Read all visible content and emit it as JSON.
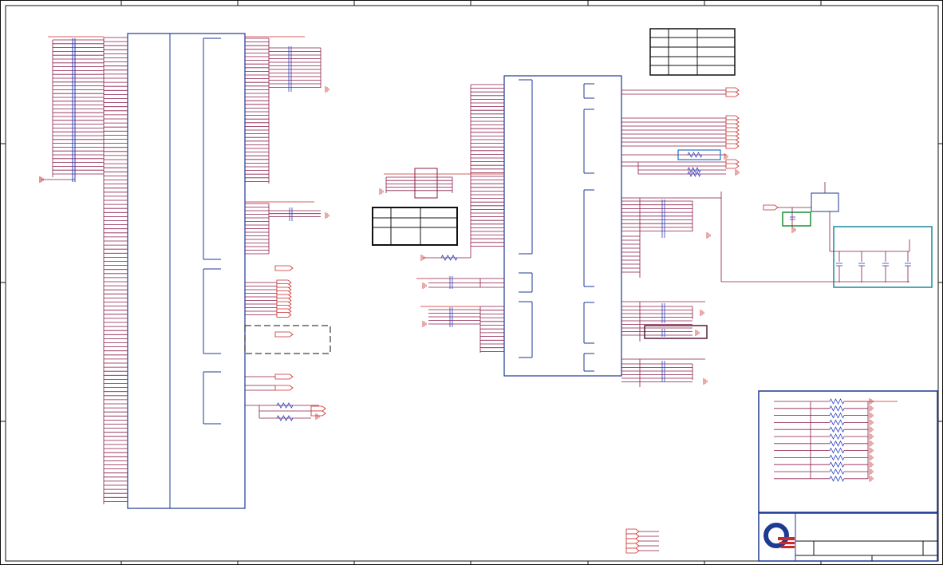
{
  "sheet": {
    "title": "",
    "vendor_logo": "quanta-logo",
    "colors": {
      "frame": "#111111",
      "block_outline": "#1f3a93",
      "wire": "#8b1c4a",
      "net_red": "#cc2a2a",
      "resistor": "#2a3fbf",
      "highlight_blue": "#1a73c9",
      "highlight_green": "#1a8f3a",
      "highlight_teal": "#1a8a9a",
      "highlight_dark": "#5a1a3a",
      "logo_primary": "#1f3a93",
      "logo_accent": "#cc2a2a"
    }
  },
  "icons": [
    "ground-symbol-icon",
    "off-page-connector-icon",
    "resistor-icon",
    "capacitor-icon",
    "mosfet-icon",
    "power-pin-icon"
  ]
}
